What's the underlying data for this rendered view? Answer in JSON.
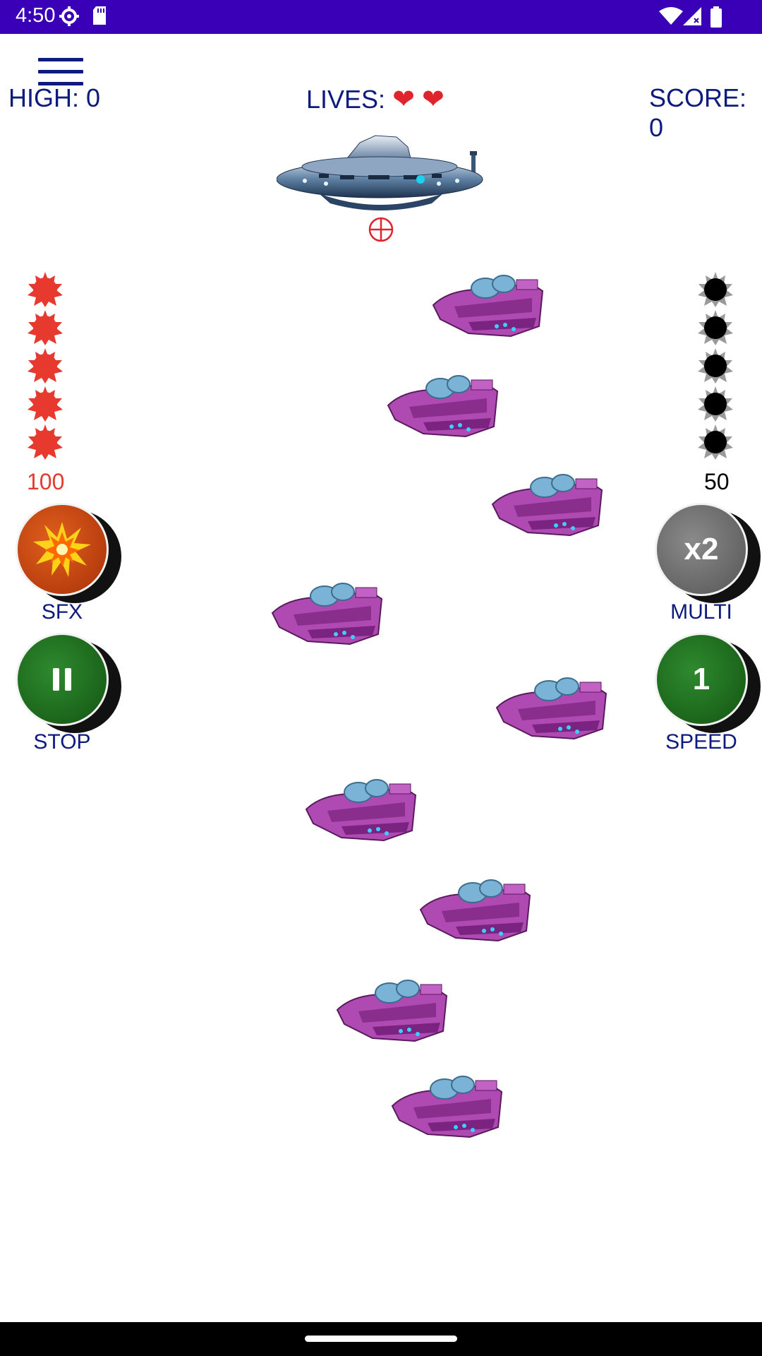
{
  "status_bar": {
    "time": "4:50",
    "icons": [
      "gear-icon",
      "sd-card-icon",
      "wifi-icon",
      "signal-icon",
      "battery-icon"
    ]
  },
  "menu": {
    "icon": "hamburger-menu-icon"
  },
  "hud": {
    "high": "HIGH: 0",
    "lives_label": "LIVES:",
    "lives_count": 2,
    "score": "SCORE: 0"
  },
  "left_meter": {
    "value": "100",
    "color": "#e8392f",
    "balls": 5
  },
  "right_meter": {
    "value": "50",
    "color": "#000000",
    "balls": 5
  },
  "buttons": {
    "sfx": {
      "label": "SFX",
      "icon": "explosion-icon",
      "color": "#c2410f"
    },
    "multi": {
      "label": "MULTI",
      "face": "x2",
      "color": "#6e6e6e"
    },
    "stop": {
      "label": "STOP",
      "icon": "pause-icon",
      "color": "#1d6b1d"
    },
    "speed": {
      "label": "SPEED",
      "face": "1",
      "color": "#1d6b1d"
    }
  },
  "player_ship": {
    "icon": "mothership-icon",
    "target": "crosshair-icon"
  },
  "enemies": {
    "count": 9,
    "color": "#b04ab3"
  }
}
